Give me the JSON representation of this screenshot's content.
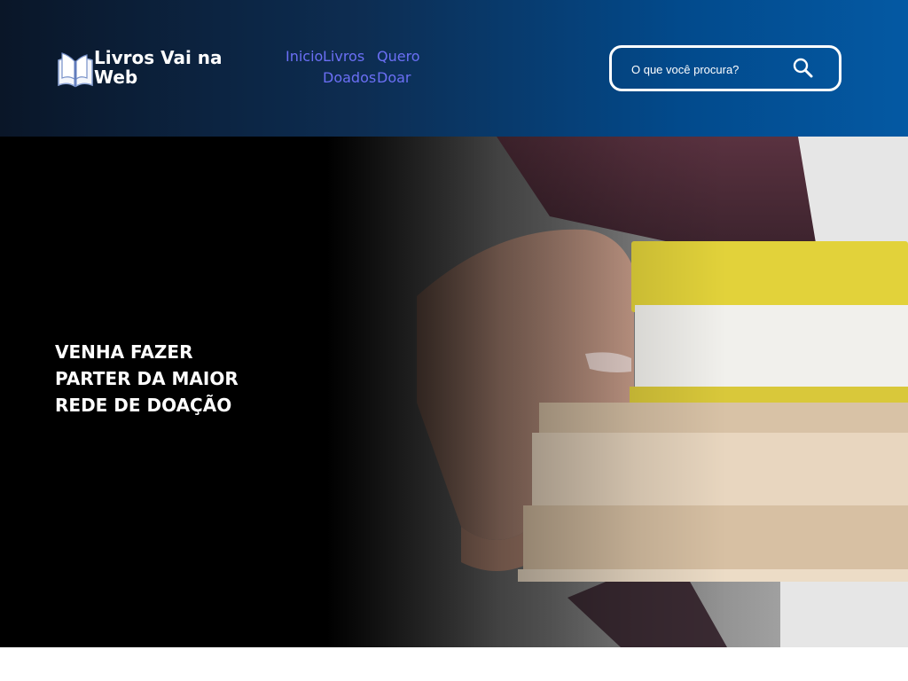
{
  "site": {
    "brand_name": "Livros Vai na Web"
  },
  "nav": {
    "items": [
      {
        "label": "Inicio"
      },
      {
        "label_line1": "Livros",
        "label_line2": "Doados"
      },
      {
        "label_line1": "Quero",
        "label_line2": "Doar"
      }
    ]
  },
  "search": {
    "placeholder": "O que você procura?",
    "icon": "search-icon"
  },
  "hero": {
    "title": "VENHA FAZER PARTER DA MAIOR REDE DE DOAÇÃO",
    "image": "hand-holding-stack-of-books"
  },
  "colors": {
    "header_dark": "#0a1628",
    "header_blue": "#0459a3",
    "nav_link": "#6b6ff5",
    "hero_text": "#ffffff"
  }
}
